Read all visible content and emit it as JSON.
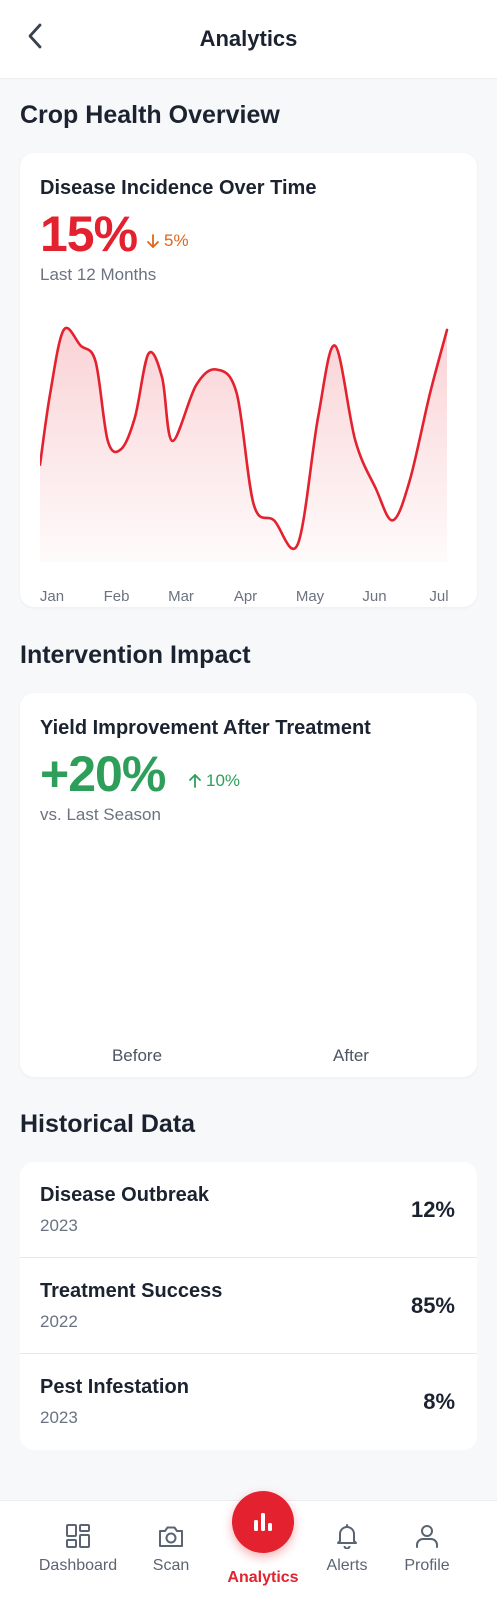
{
  "header": {
    "title": "Analytics",
    "back_icon": "chevron-left-icon"
  },
  "crop_health": {
    "section_title": "Crop Health Overview",
    "card_title": "Disease Incidence Over Time",
    "value": "15%",
    "delta": "5%",
    "delta_direction": "down",
    "period": "Last 12 Months",
    "accent_color": "#e3212f",
    "delta_color": "#e0661c"
  },
  "chart_data": {
    "type": "area",
    "title": "Disease Incidence Over Time",
    "categories": [
      "Jan",
      "Feb",
      "Mar",
      "Apr",
      "May",
      "Jun",
      "Jul"
    ],
    "x": [
      0,
      0.15,
      0.35,
      0.6,
      0.82,
      1.0,
      1.2,
      1.4,
      1.6,
      1.8,
      1.95,
      2.3,
      2.6,
      2.9,
      3.15,
      3.45,
      3.8,
      4.1,
      4.35,
      4.65,
      4.95,
      5.2,
      5.45,
      5.75,
      6.0
    ],
    "series": [
      {
        "values": [
          11,
          20,
          28,
          26,
          24,
          14,
          13,
          17,
          25,
          22,
          14,
          21,
          23,
          20,
          6,
          4,
          1,
          17,
          26,
          14,
          8,
          4,
          9,
          20,
          28
        ]
      }
    ],
    "ylim": [
      0,
      30
    ],
    "grid": false,
    "line_color": "#e3212f"
  },
  "intervention": {
    "section_title": "Intervention Impact",
    "card_title": "Yield Improvement After Treatment",
    "value": "+20%",
    "delta": "10%",
    "delta_direction": "up",
    "comparison": "vs. Last Season",
    "bars": [
      {
        "label": "Before"
      },
      {
        "label": "After"
      }
    ],
    "accent_color": "#2e9e5b"
  },
  "historical": {
    "section_title": "Historical Data",
    "rows": [
      {
        "name": "Disease Outbreak",
        "year": "2023",
        "value": "12%"
      },
      {
        "name": "Treatment Success",
        "year": "2022",
        "value": "85%"
      },
      {
        "name": "Pest Infestation",
        "year": "2023",
        "value": "8%"
      }
    ]
  },
  "nav": {
    "items": [
      {
        "label": "Dashboard",
        "icon": "dashboard-icon"
      },
      {
        "label": "Scan",
        "icon": "camera-icon"
      },
      {
        "label": "Analytics",
        "icon": "bar-chart-icon",
        "active": true
      },
      {
        "label": "Alerts",
        "icon": "bell-icon"
      },
      {
        "label": "Profile",
        "icon": "user-icon"
      }
    ],
    "active_color": "#e3212f"
  }
}
